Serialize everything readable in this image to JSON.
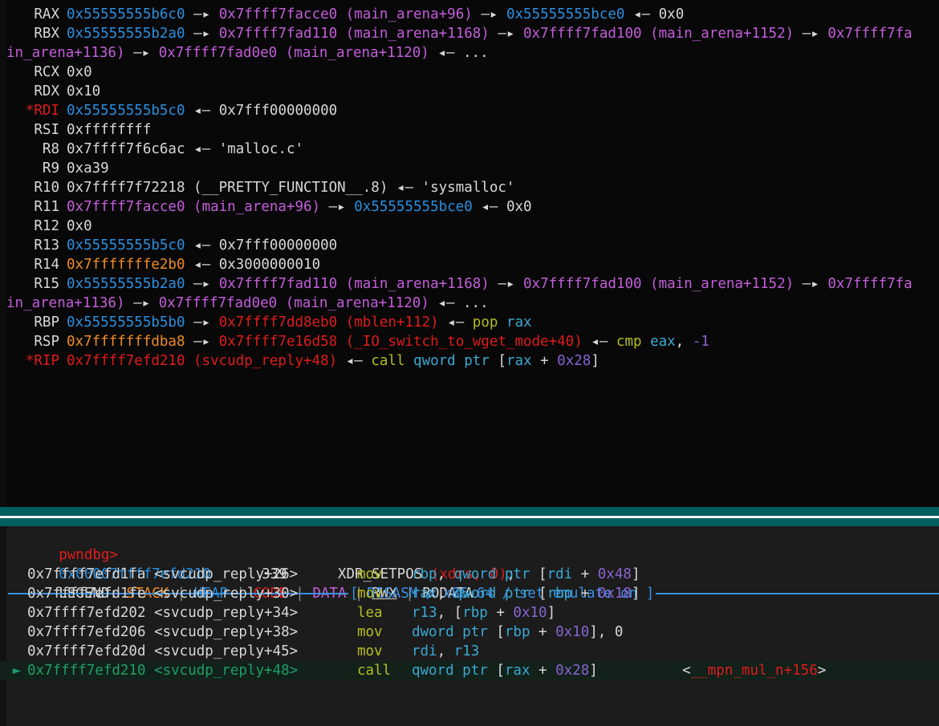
{
  "registers_panel": {
    "name": "registers",
    "lines": [
      {
        "reg": "RAX",
        "flagged": false,
        "segments": [
          {
            "t": "0x55555555b6c0",
            "c": "heap"
          },
          {
            "t": " ",
            "c": "white"
          },
          {
            "t": "—▸",
            "c": "white"
          },
          {
            "t": " ",
            "c": "white"
          },
          {
            "t": "0x7ffff7facce0 (main_arena+96)",
            "c": "data"
          },
          {
            "t": " ",
            "c": "white"
          },
          {
            "t": "—▸",
            "c": "white"
          },
          {
            "t": " ",
            "c": "white"
          },
          {
            "t": "0x55555555bce0",
            "c": "heap"
          },
          {
            "t": " ",
            "c": "white"
          },
          {
            "t": "◂—",
            "c": "white"
          },
          {
            "t": " ",
            "c": "white"
          },
          {
            "t": "0x0",
            "c": "white"
          }
        ]
      },
      {
        "reg": "RBX",
        "flagged": false,
        "segments": [
          {
            "t": "0x55555555b2a0",
            "c": "heap"
          },
          {
            "t": " ",
            "c": "white"
          },
          {
            "t": "—▸",
            "c": "white"
          },
          {
            "t": " ",
            "c": "white"
          },
          {
            "t": "0x7ffff7fad110 (main_arena+1168)",
            "c": "data"
          },
          {
            "t": " ",
            "c": "white"
          },
          {
            "t": "—▸",
            "c": "white"
          },
          {
            "t": " ",
            "c": "white"
          },
          {
            "t": "0x7ffff7fad100 (main_arena+1152)",
            "c": "data"
          },
          {
            "t": " ",
            "c": "white"
          },
          {
            "t": "—▸",
            "c": "white"
          },
          {
            "t": " ",
            "c": "white"
          },
          {
            "t": "0x7ffff7fa",
            "c": "data"
          }
        ]
      },
      {
        "reg": "",
        "flagged": false,
        "continuation": true,
        "segments": [
          {
            "t": "in_arena+1136)",
            "c": "data"
          },
          {
            "t": " ",
            "c": "white"
          },
          {
            "t": "—▸",
            "c": "white"
          },
          {
            "t": " ",
            "c": "white"
          },
          {
            "t": "0x7ffff7fad0e0 (main_arena+1120)",
            "c": "data"
          },
          {
            "t": " ",
            "c": "white"
          },
          {
            "t": "◂—",
            "c": "white"
          },
          {
            "t": " ",
            "c": "white"
          },
          {
            "t": "...",
            "c": "white"
          }
        ]
      },
      {
        "reg": "RCX",
        "flagged": false,
        "segments": [
          {
            "t": "0x0",
            "c": "white"
          }
        ]
      },
      {
        "reg": "RDX",
        "flagged": false,
        "segments": [
          {
            "t": "0x10",
            "c": "white"
          }
        ]
      },
      {
        "reg": "*RDI",
        "flagged": true,
        "segments": [
          {
            "t": "0x55555555b5c0",
            "c": "heap"
          },
          {
            "t": " ",
            "c": "white"
          },
          {
            "t": "◂—",
            "c": "white"
          },
          {
            "t": " ",
            "c": "white"
          },
          {
            "t": "0x7fff00000000",
            "c": "white"
          }
        ]
      },
      {
        "reg": "RSI",
        "flagged": false,
        "segments": [
          {
            "t": "0xffffffff",
            "c": "white"
          }
        ]
      },
      {
        "reg": "R8",
        "flagged": false,
        "segments": [
          {
            "t": "0x7ffff7f6c6ac",
            "c": "white"
          },
          {
            "t": " ",
            "c": "white"
          },
          {
            "t": "◂—",
            "c": "white"
          },
          {
            "t": " ",
            "c": "white"
          },
          {
            "t": "'malloc.c'",
            "c": "white"
          }
        ]
      },
      {
        "reg": "R9",
        "flagged": false,
        "segments": [
          {
            "t": "0xa39",
            "c": "white"
          }
        ]
      },
      {
        "reg": "R10",
        "flagged": false,
        "segments": [
          {
            "t": "0x7ffff7f72218 (__PRETTY_FUNCTION__.8)",
            "c": "white"
          },
          {
            "t": " ",
            "c": "white"
          },
          {
            "t": "◂—",
            "c": "white"
          },
          {
            "t": " ",
            "c": "white"
          },
          {
            "t": "'sysmalloc'",
            "c": "white"
          }
        ]
      },
      {
        "reg": "R11",
        "flagged": false,
        "segments": [
          {
            "t": "0x7ffff7facce0 (main_arena+96)",
            "c": "data"
          },
          {
            "t": " ",
            "c": "white"
          },
          {
            "t": "—▸",
            "c": "white"
          },
          {
            "t": " ",
            "c": "white"
          },
          {
            "t": "0x55555555bce0",
            "c": "heap"
          },
          {
            "t": " ",
            "c": "white"
          },
          {
            "t": "◂—",
            "c": "white"
          },
          {
            "t": " ",
            "c": "white"
          },
          {
            "t": "0x0",
            "c": "white"
          }
        ]
      },
      {
        "reg": "R12",
        "flagged": false,
        "segments": [
          {
            "t": "0x0",
            "c": "white"
          }
        ]
      },
      {
        "reg": "R13",
        "flagged": false,
        "segments": [
          {
            "t": "0x55555555b5c0",
            "c": "heap"
          },
          {
            "t": " ",
            "c": "white"
          },
          {
            "t": "◂—",
            "c": "white"
          },
          {
            "t": " ",
            "c": "white"
          },
          {
            "t": "0x7fff00000000",
            "c": "white"
          }
        ]
      },
      {
        "reg": "R14",
        "flagged": false,
        "segments": [
          {
            "t": "0x7fffffffe2b0",
            "c": "stack"
          },
          {
            "t": " ",
            "c": "white"
          },
          {
            "t": "◂—",
            "c": "white"
          },
          {
            "t": " ",
            "c": "white"
          },
          {
            "t": "0x3000000010",
            "c": "white"
          }
        ]
      },
      {
        "reg": "R15",
        "flagged": false,
        "segments": [
          {
            "t": "0x55555555b2a0",
            "c": "heap"
          },
          {
            "t": " ",
            "c": "white"
          },
          {
            "t": "—▸",
            "c": "white"
          },
          {
            "t": " ",
            "c": "white"
          },
          {
            "t": "0x7ffff7fad110 (main_arena+1168)",
            "c": "data"
          },
          {
            "t": " ",
            "c": "white"
          },
          {
            "t": "—▸",
            "c": "white"
          },
          {
            "t": " ",
            "c": "white"
          },
          {
            "t": "0x7ffff7fad100 (main_arena+1152)",
            "c": "data"
          },
          {
            "t": " ",
            "c": "white"
          },
          {
            "t": "—▸",
            "c": "white"
          },
          {
            "t": " ",
            "c": "white"
          },
          {
            "t": "0x7ffff7fa",
            "c": "data"
          }
        ]
      },
      {
        "reg": "",
        "flagged": false,
        "continuation": true,
        "segments": [
          {
            "t": "in_arena+1136)",
            "c": "data"
          },
          {
            "t": " ",
            "c": "white"
          },
          {
            "t": "—▸",
            "c": "white"
          },
          {
            "t": " ",
            "c": "white"
          },
          {
            "t": "0x7ffff7fad0e0 (main_arena+1120)",
            "c": "data"
          },
          {
            "t": " ",
            "c": "white"
          },
          {
            "t": "◂—",
            "c": "white"
          },
          {
            "t": " ",
            "c": "white"
          },
          {
            "t": "...",
            "c": "white"
          }
        ]
      },
      {
        "reg": "RBP",
        "flagged": false,
        "segments": [
          {
            "t": "0x55555555b5b0",
            "c": "heap"
          },
          {
            "t": " ",
            "c": "white"
          },
          {
            "t": "—▸",
            "c": "white"
          },
          {
            "t": " ",
            "c": "white"
          },
          {
            "t": "0x7ffff7dd8eb0 (mblen+112)",
            "c": "code"
          },
          {
            "t": " ",
            "c": "white"
          },
          {
            "t": "◂—",
            "c": "white"
          },
          {
            "t": " ",
            "c": "white"
          },
          {
            "t": "pop",
            "c": "mnem"
          },
          {
            "t": " ",
            "c": "white"
          },
          {
            "t": "rax",
            "c": "reg"
          }
        ]
      },
      {
        "reg": "RSP",
        "flagged": false,
        "segments": [
          {
            "t": "0x7fffffffdba8",
            "c": "stack"
          },
          {
            "t": " ",
            "c": "white"
          },
          {
            "t": "—▸",
            "c": "white"
          },
          {
            "t": " ",
            "c": "white"
          },
          {
            "t": "0x7ffff7e16d58 (_IO_switch_to_wget_mode+40)",
            "c": "code"
          },
          {
            "t": " ",
            "c": "white"
          },
          {
            "t": "◂—",
            "c": "white"
          },
          {
            "t": " ",
            "c": "white"
          },
          {
            "t": "cmp",
            "c": "mnem"
          },
          {
            "t": " ",
            "c": "white"
          },
          {
            "t": "eax",
            "c": "reg"
          },
          {
            "t": ", ",
            "c": "white"
          },
          {
            "t": "-1",
            "c": "imm"
          }
        ]
      },
      {
        "reg": "*RIP",
        "flagged": true,
        "segments": [
          {
            "t": "0x7ffff7efd210 (svcudp_reply+48)",
            "c": "code"
          },
          {
            "t": " ",
            "c": "white"
          },
          {
            "t": "◂—",
            "c": "white"
          },
          {
            "t": " ",
            "c": "white"
          },
          {
            "t": "call",
            "c": "mnem"
          },
          {
            "t": " ",
            "c": "white"
          },
          {
            "t": "qword ptr",
            "c": "reg"
          },
          {
            "t": " ",
            "c": "white"
          },
          {
            "t": "[",
            "c": "white"
          },
          {
            "t": "rax",
            "c": "reg"
          },
          {
            "t": " + ",
            "c": "white"
          },
          {
            "t": "0x28",
            "c": "imm"
          },
          {
            "t": "]",
            "c": "white"
          }
        ]
      }
    ]
  },
  "console": {
    "prompt": "pwndbg>",
    "source_line": {
      "address": "0x00007ffff7efd210",
      "line_number": "339",
      "code_name": "XDR_SETPOS",
      "code_args": "(xdrs, 0)",
      "code_terminator": ";"
    },
    "legend": {
      "label": "LEGEND:",
      "separator": "|",
      "items": [
        {
          "label": "STACK",
          "color_class": "stack"
        },
        {
          "label": "HEAP",
          "color_class": "heap"
        },
        {
          "label": "CODE",
          "color_class": "code"
        },
        {
          "label": "DATA",
          "color_class": "data"
        },
        {
          "label": "RWX",
          "color_class": "rwx"
        },
        {
          "label": "RODATA",
          "color_class": "rodata"
        }
      ]
    },
    "disasm_banner": "[ DISASM / x86-64 / set emulate on ]"
  },
  "disassembly": {
    "lines": [
      {
        "marker": "",
        "current": false,
        "address": "0x7ffff7efd1fa",
        "symbol": "<svcudp_reply+26>",
        "mnemonic": "mov",
        "operands": [
          {
            "t": "rbp",
            "c": "reg"
          },
          {
            "t": ", ",
            "c": "white"
          },
          {
            "t": "qword ptr",
            "c": "reg"
          },
          {
            "t": " ",
            "c": "white"
          },
          {
            "t": "[",
            "c": "white"
          },
          {
            "t": "rdi",
            "c": "reg"
          },
          {
            "t": " + ",
            "c": "white"
          },
          {
            "t": "0x48",
            "c": "imm"
          },
          {
            "t": "]",
            "c": "white"
          }
        ],
        "target": ""
      },
      {
        "marker": "",
        "current": false,
        "address": "0x7ffff7efd1fe",
        "symbol": "<svcudp_reply+30>",
        "mnemonic": "mov",
        "operands": [
          {
            "t": "rax",
            "c": "reg"
          },
          {
            "t": ", ",
            "c": "white"
          },
          {
            "t": "qword ptr",
            "c": "reg"
          },
          {
            "t": " ",
            "c": "white"
          },
          {
            "t": "[",
            "c": "white"
          },
          {
            "t": "rbp",
            "c": "reg"
          },
          {
            "t": " + ",
            "c": "white"
          },
          {
            "t": "0x18",
            "c": "imm"
          },
          {
            "t": "]",
            "c": "white"
          }
        ],
        "target": ""
      },
      {
        "marker": "",
        "current": false,
        "address": "0x7ffff7efd202",
        "symbol": "<svcudp_reply+34>",
        "mnemonic": "lea",
        "operands": [
          {
            "t": "r13",
            "c": "reg"
          },
          {
            "t": ", ",
            "c": "white"
          },
          {
            "t": "[",
            "c": "white"
          },
          {
            "t": "rbp",
            "c": "reg"
          },
          {
            "t": " + ",
            "c": "white"
          },
          {
            "t": "0x10",
            "c": "imm"
          },
          {
            "t": "]",
            "c": "white"
          }
        ],
        "target": ""
      },
      {
        "marker": "",
        "current": false,
        "address": "0x7ffff7efd206",
        "symbol": "<svcudp_reply+38>",
        "mnemonic": "mov",
        "operands": [
          {
            "t": "dword ptr",
            "c": "reg"
          },
          {
            "t": " ",
            "c": "white"
          },
          {
            "t": "[",
            "c": "white"
          },
          {
            "t": "rbp",
            "c": "reg"
          },
          {
            "t": " + ",
            "c": "white"
          },
          {
            "t": "0x10",
            "c": "imm"
          },
          {
            "t": "], ",
            "c": "white"
          },
          {
            "t": "0",
            "c": "white"
          }
        ],
        "target": ""
      },
      {
        "marker": "",
        "current": false,
        "address": "0x7ffff7efd20d",
        "symbol": "<svcudp_reply+45>",
        "mnemonic": "mov",
        "operands": [
          {
            "t": "rdi",
            "c": "reg"
          },
          {
            "t": ", ",
            "c": "white"
          },
          {
            "t": "r13",
            "c": "reg"
          }
        ],
        "target": ""
      },
      {
        "marker": "►",
        "current": true,
        "address": "0x7ffff7efd210",
        "symbol": "<svcudp_reply+48>",
        "mnemonic": "call",
        "operands": [
          {
            "t": "qword ptr",
            "c": "reg"
          },
          {
            "t": " ",
            "c": "white"
          },
          {
            "t": "[",
            "c": "white"
          },
          {
            "t": "rax",
            "c": "reg"
          },
          {
            "t": " + ",
            "c": "white"
          },
          {
            "t": "0x28",
            "c": "imm"
          },
          {
            "t": "]",
            "c": "white"
          }
        ],
        "target": "<__mpn_mul_n+156>",
        "target_symbol": "__mpn_mul_n+156"
      }
    ]
  },
  "colors": {
    "background_registers": "#080808",
    "background_console": "#1c1c1c",
    "gutter": "#0d0d0d",
    "band": "#006060",
    "band_rule": "#f2f2f2",
    "stack": "#f08a24",
    "heap": "#2a8fe0",
    "code": "#e01b1b",
    "data": "#c45ddb",
    "rodata": "#d8d8d8",
    "mnemonic": "#b5bd1f",
    "register_operand": "#3aa9d4",
    "immediate": "#8a63d2",
    "current_instruction": "#1e9e6a",
    "banner": "#3a8fe0",
    "prompt": "#e01b1b"
  }
}
